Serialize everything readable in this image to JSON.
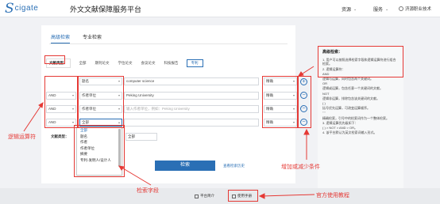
{
  "header": {
    "logo_s": "S",
    "logo_text": "cigate",
    "title": "外文文献保障服务平台",
    "nav": [
      {
        "label": "资源"
      },
      {
        "label": "服务"
      }
    ],
    "user": "济源职业技术"
  },
  "tabs": [
    {
      "label": "高级检索",
      "active": true
    },
    {
      "label": "专业检索",
      "active": false
    }
  ],
  "doc_types": {
    "label": "文献类型：",
    "options": [
      {
        "label": "全部",
        "selected": false
      },
      {
        "label": "期刊论文",
        "selected": false
      },
      {
        "label": "学位论文",
        "selected": false
      },
      {
        "label": "会议论文",
        "selected": false
      },
      {
        "label": "科技报告",
        "selected": false
      },
      {
        "label": "专利",
        "selected": true
      }
    ]
  },
  "rows": [
    {
      "logic": "",
      "field": "题名",
      "value": "computer science",
      "value_placeholder": "",
      "match": "精确"
    },
    {
      "logic": "AND",
      "field": "作者单位",
      "value": "Peking University",
      "value_placeholder": "",
      "match": "精确"
    },
    {
      "logic": "AND",
      "field": "作者单位",
      "value": "",
      "value_placeholder": "输入作者单位，例如：Peking University",
      "match": "精确"
    },
    {
      "logic": "AND",
      "field": "全部",
      "value": "",
      "value_placeholder": "",
      "match": "精确"
    }
  ],
  "field_dropdown": [
    "全部",
    "题名",
    "作者",
    "作者单位",
    "摘要",
    "专利-发明人/设计人"
  ],
  "sub_filter": {
    "label": "文献类型：",
    "value": "全部"
  },
  "search_button": "检索",
  "history_link": "查看检索历史",
  "tips": {
    "title": "高级检索：",
    "lines": [
      "1. 用户可以按照选择检索字段和逻辑运算符进行组合检索。",
      "2. 逻辑运算符：",
      "AND",
      "逻辑与运算，同时包含两个关键词。",
      "OR",
      "逻辑或运算，包含任意一个关键词的文献。",
      "NOT",
      "逻辑非运算，排除包含该关键词的文献。",
      "( )",
      "括号优先运算，可改变运算顺序。",
      "\" \"",
      "精确检索，引号中的检索词作为一个整体检索。",
      "3. 逻辑运算优先级如下：",
      "( ) > NOT > AND > OR。",
      "4. 该平台默认为英文检索词输入形式。"
    ]
  },
  "circle_buttons": [
    "+",
    "−",
    "−",
    "−"
  ],
  "footer": {
    "intro": "平台简介",
    "manual": "使用手册"
  },
  "annotations": {
    "logic": "逻辑运算符",
    "fields": "检索字段",
    "add_remove": "增加或减少条件",
    "manual": "官方使用教程"
  },
  "colors": {
    "accent": "#2a6fb5",
    "annotation": "#e53935"
  }
}
